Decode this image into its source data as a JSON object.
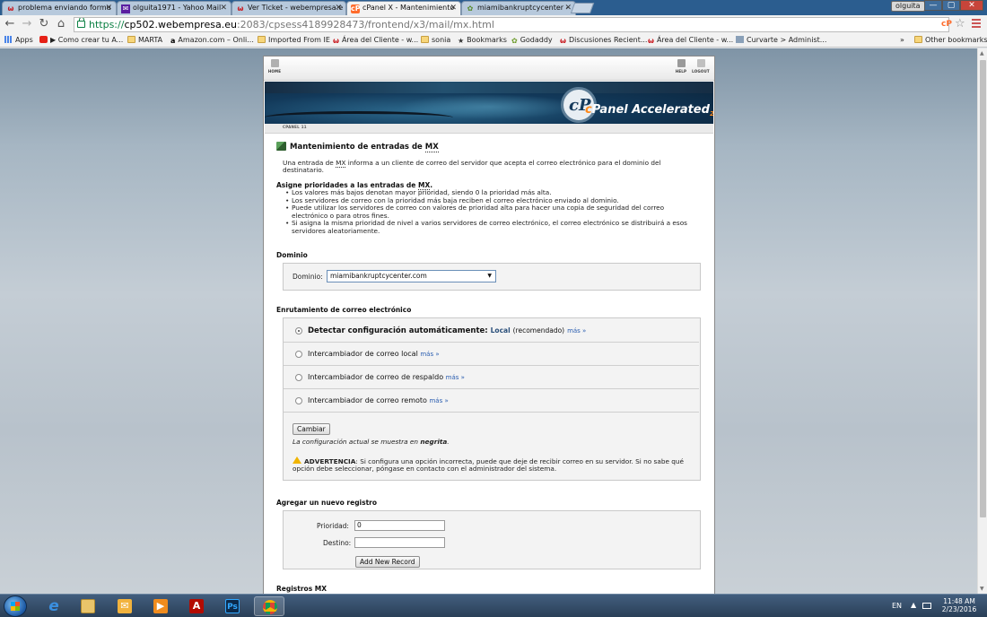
{
  "browser": {
    "tabs": [
      {
        "label": "problema enviando formu",
        "favicon": "w-icon",
        "active": false
      },
      {
        "label": "olguita1971 - Yahoo Mail",
        "favicon": "yahoo-mail-icon",
        "active": false
      },
      {
        "label": "Ver Ticket - webempresa.e",
        "favicon": "w-icon",
        "active": false
      },
      {
        "label": "cPanel X - Mantenimiento",
        "favicon": "cpanel-icon",
        "active": true
      },
      {
        "label": "miamibankruptcycenter -",
        "favicon": "site-icon",
        "active": false
      }
    ],
    "user_badge": "olguita",
    "window_controls": [
      "—",
      "▢",
      "✕"
    ],
    "url": {
      "scheme": "https://",
      "host": "cp502.webempresa.eu",
      "rest": ":2083/cpsess4189928473/frontend/x3/mail/mx.html"
    },
    "extension_label": "cP",
    "bookmarks": [
      {
        "label": "Apps",
        "icon": "apps-icon"
      },
      {
        "label": "Como crear tu A...",
        "icon": "youtube-icon"
      },
      {
        "label": "MARTA",
        "icon": "folder-icon"
      },
      {
        "label": "Amazon.com – Onli...",
        "icon": "amazon-icon"
      },
      {
        "label": "Imported From IE",
        "icon": "folder-icon"
      },
      {
        "label": "Área del Cliente - w...",
        "icon": "w-icon"
      },
      {
        "label": "sonia",
        "icon": "folder-icon"
      },
      {
        "label": "Bookmarks",
        "icon": "star-icon"
      },
      {
        "label": "Godaddy",
        "icon": "godaddy-icon"
      },
      {
        "label": "Discusiones Recient...",
        "icon": "w-icon"
      },
      {
        "label": "Área del Cliente - w...",
        "icon": "w-icon"
      },
      {
        "label": "Curvarte > Administ...",
        "icon": "curvarte-icon"
      }
    ],
    "bookmarks_overflow": "»",
    "other_bookmarks": "Other bookmarks"
  },
  "cpanel": {
    "nav": {
      "home": "HOME",
      "help": "HELP",
      "logout": "LOGOUT"
    },
    "logo_text": "Panel",
    "logo_accent": "Accelerated",
    "logo_sub": "2",
    "version": "CPANEL 11",
    "title_prefix": "Mantenimiento de entradas de ",
    "title_abbr": "MX",
    "intro_part1": "Una entrada de ",
    "intro_abbr": "MX",
    "intro_part2": " informa a un cliente de correo del servidor que acepta el correo electrónico para el dominio del destinatario.",
    "priorities_heading_prefix": "Asigne prioridades a las entradas de ",
    "priorities_heading_abbr": "MX",
    "priorities_heading_suffix": ".",
    "priority_bullets": [
      "Los valores más bajos denotan mayor prioridad, siendo 0 la prioridad más alta.",
      "Los servidores de correo con la prioridad más baja reciben el correo electrónico enviado al dominio.",
      "Puede utilizar los servidores de correo con valores de prioridad alta para hacer una copia de seguridad del correo electrónico o para otros fines.",
      "Si asigna la misma prioridad de nivel a varios servidores de correo electrónico, el correo electrónico se distribuirá a esos servidores aleatoriamente."
    ],
    "domain_section_heading": "Dominio",
    "domain_label": "Dominio:",
    "domain_value": "miamibankruptcycenter.com",
    "routing_heading": "Enrutamiento de correo electrónico",
    "routing_options": [
      {
        "label": "Detectar configuración automáticamente:",
        "value": "Local",
        "note": "(recomendado)",
        "more": "más »",
        "checked": true
      },
      {
        "label": "Intercambiador de correo local",
        "more": "más »",
        "checked": false
      },
      {
        "label": "Intercambiador de correo de respaldo",
        "more": "más »",
        "checked": false
      },
      {
        "label": "Intercambiador de correo remoto",
        "more": "más »",
        "checked": false
      }
    ],
    "change_button": "Cambiar",
    "current_config_prefix": "La configuración actual se muestra en ",
    "current_config_bold": "negrita",
    "current_config_suffix": ".",
    "warning_label": "ADVERTENCIA",
    "warning_text": ": Si configura una opción incorrecta, puede que deje de recibir correo en su servidor. Si no sabe qué opción debe seleccionar, póngase en contacto con el administrador del sistema.",
    "add_record_heading": "Agregar un nuevo registro",
    "priority_label": "Prioridad:",
    "priority_value": "0",
    "destination_label": "Destino:",
    "destination_value": "",
    "add_button": "Add New Record",
    "records_heading": "Registros MX"
  },
  "taskbar": {
    "apps": [
      {
        "name": "internet-explorer",
        "open": false
      },
      {
        "name": "file-explorer",
        "open": false
      },
      {
        "name": "outlook",
        "open": false
      },
      {
        "name": "media-player",
        "open": false
      },
      {
        "name": "acrobat",
        "open": false
      },
      {
        "name": "photoshop",
        "open": false
      },
      {
        "name": "chrome",
        "open": true
      }
    ],
    "tray_lang": "EN",
    "clock_time": "11:48 AM",
    "clock_date": "2/23/2016"
  }
}
